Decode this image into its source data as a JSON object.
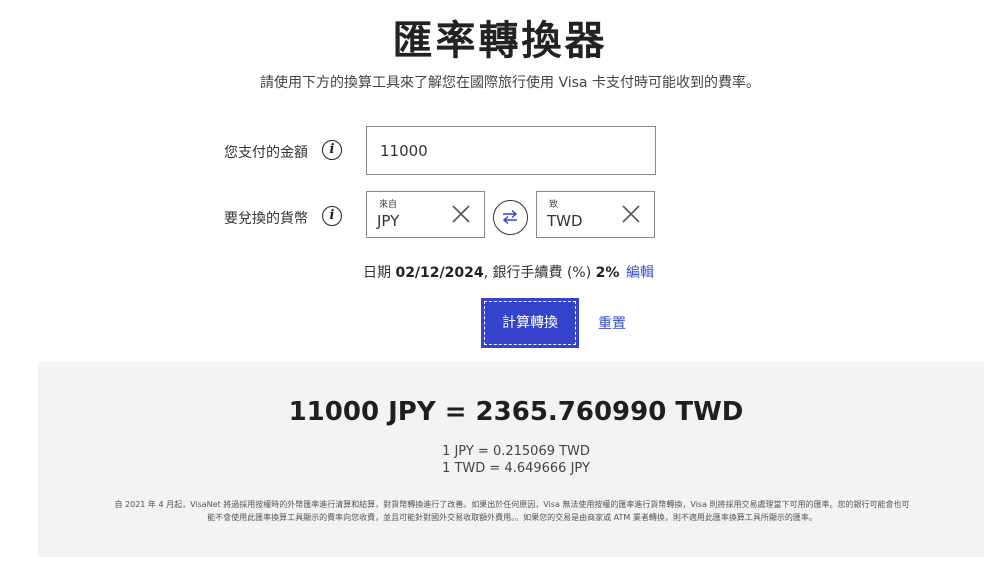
{
  "header": {
    "title": "匯率轉換器",
    "subtitle": "請使用下方的換算工具來了解您在國際旅行使用 Visa 卡支付時可能收到的費率。"
  },
  "form": {
    "amount_label": "您支付的金額",
    "amount_value": "11000",
    "currency_label": "要兌換的貨幣",
    "from_caption": "來自",
    "from_currency": "JPY",
    "to_caption": "致",
    "to_currency": "TWD",
    "date_prefix": "日期",
    "date_value": "02/12/2024",
    "fee_text": ", 銀行手續費 (%)",
    "fee_value": "2%",
    "edit_label": "編輯",
    "calculate_label": "計算轉換",
    "reset_label": "重置"
  },
  "result": {
    "headline": "11000 JPY = 2365.760990 TWD",
    "rate_forward": "1 JPY = 0.215069 TWD",
    "rate_reverse": "1 TWD = 4.649666 JPY",
    "disclaimer_line1": "自 2021 年 4 月起，VisaNet 將過採用按權時的外幣匯率進行清算和結算，對貨幣轉換進行了改善。如果出於任何原因，Visa 無法使用按權的匯率進行貨幣轉換，Visa 則將採用交易處理當下可用的匯率。您的銀行可能會也可",
    "disclaimer_line2": "能不會使用此匯率換算工具顯示的費率向您收費，並且可能針對國外交易收取額外費用。。如果您的交易是由商家或 ATM 業者轉換，則不適用此匯率換算工具所顯示的匯率。"
  },
  "colors": {
    "accent": "#3543cc",
    "link": "#3a4ccf",
    "panel": "#f3f3f3"
  },
  "icons": {
    "info": "info-icon",
    "clear": "close-icon",
    "swap": "swap-arrows-icon"
  }
}
